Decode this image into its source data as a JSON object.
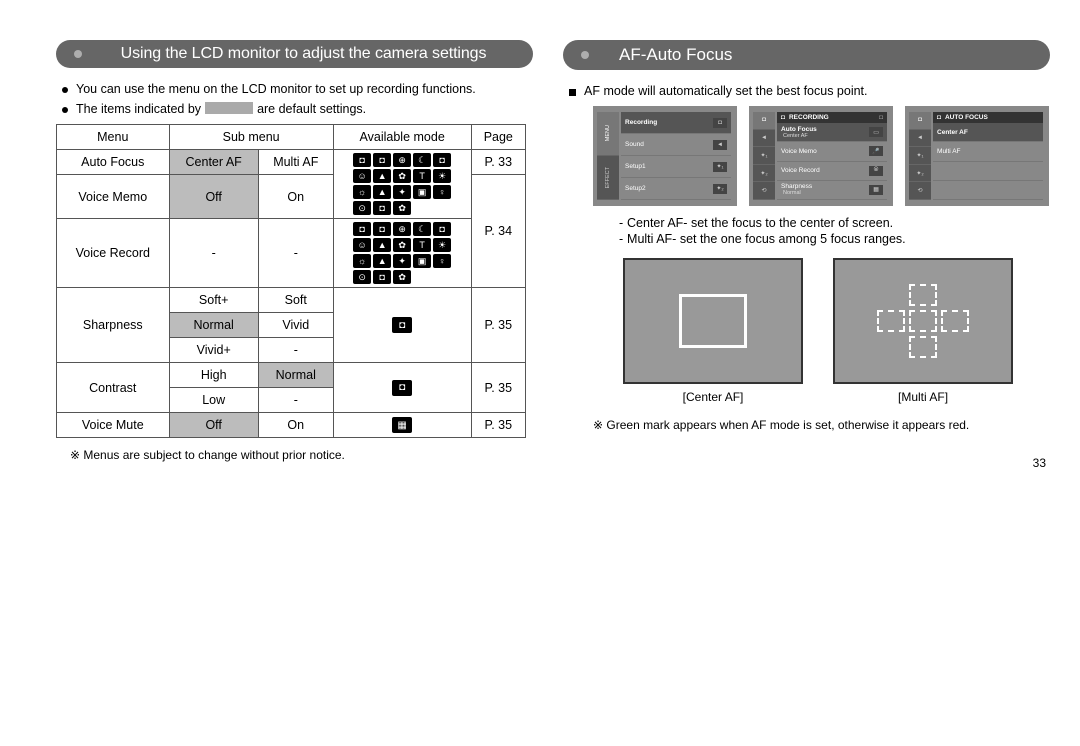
{
  "page_number": "33",
  "left": {
    "title": "Using the LCD monitor to adjust the camera settings",
    "intro1": "You can use the menu on the LCD monitor to set up recording functions.",
    "intro2_a": "The items indicated by",
    "intro2_b": "are default settings.",
    "table": {
      "headers": {
        "menu": "Menu",
        "submenu": "Sub menu",
        "mode": "Available mode",
        "page": "Page"
      },
      "rows": {
        "autofocus": {
          "menu": "Auto Focus",
          "s1": "Center AF",
          "s2": "Multi AF",
          "page": "P. 33"
        },
        "vmemo": {
          "menu": "Voice Memo",
          "s1": "Off",
          "s2": "On",
          "page": "P. 34"
        },
        "vrecord": {
          "menu": "Voice Record",
          "s1": "-",
          "s2": "-"
        },
        "sharp": {
          "menu": "Sharpness",
          "r1a": "Soft+",
          "r1b": "Soft",
          "r2a": "Normal",
          "r2b": "Vivid",
          "r3a": "Vivid+",
          "r3b": "-",
          "page": "P. 35"
        },
        "contrast": {
          "menu": "Contrast",
          "r1a": "High",
          "r1b": "Normal",
          "r2a": "Low",
          "r2b": "-",
          "page": "P. 35"
        },
        "vmute": {
          "menu": "Voice Mute",
          "s1": "Off",
          "s2": "On",
          "page": "P. 35"
        }
      }
    },
    "footnote": "※ Menus are subject to change without prior notice."
  },
  "right": {
    "title": "AF-Auto Focus",
    "intro": "AF mode will automatically set the best focus point.",
    "lcd1": {
      "side_menu": "MENU",
      "side_effect": "EFFECT",
      "rows": [
        "Recording",
        "Sound",
        "Setup1",
        "Setup2"
      ]
    },
    "lcd2": {
      "hdr": "RECORDING",
      "rows": [
        {
          "l": "Auto Focus",
          "sub": "Center AF"
        },
        {
          "l": "Voice Memo"
        },
        {
          "l": "Voice Record"
        },
        {
          "l": "Sharpness",
          "sub": "Normal"
        }
      ]
    },
    "lcd3": {
      "hdr": "AUTO FOCUS",
      "rows": [
        "Center AF",
        "Multi AF"
      ]
    },
    "desc1": "Center AF- set the focus to the center of screen.",
    "desc2": "Multi AF- set the one focus among 5 focus ranges.",
    "cap1": "[Center AF]",
    "cap2": "[Multi AF]",
    "footnote": "※ Green mark appears when AF mode is set, otherwise it appears red."
  }
}
